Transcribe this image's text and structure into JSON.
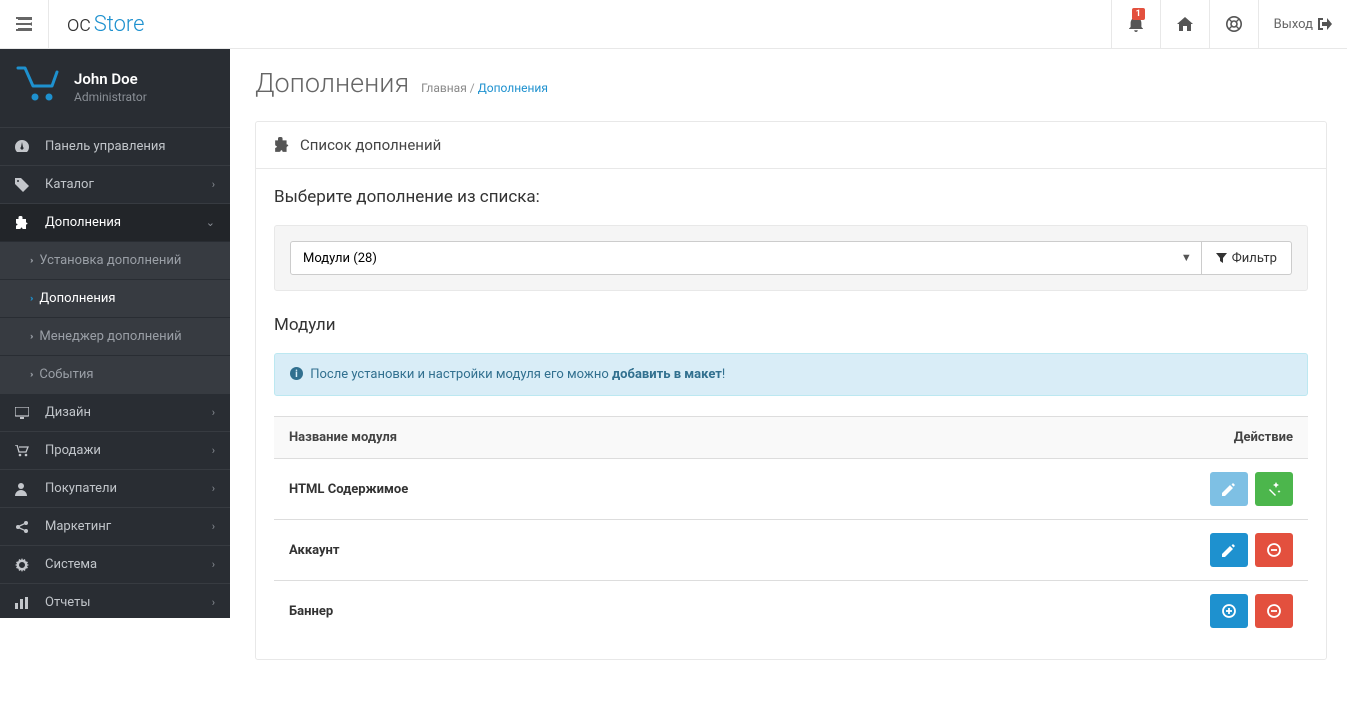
{
  "header": {
    "logo_oc": "oc",
    "logo_store": "Store",
    "notification_count": "1",
    "logout_label": "Выход"
  },
  "user": {
    "name": "John Doe",
    "role": "Administrator"
  },
  "sidebar": {
    "dashboard": "Панель управления",
    "catalog": "Каталог",
    "extensions": "Дополнения",
    "design": "Дизайн",
    "sales": "Продажи",
    "customers": "Покупатели",
    "marketing": "Маркетинг",
    "system": "Система",
    "reports": "Отчеты",
    "sub": {
      "installer": "Установка дополнений",
      "extensions": "Дополнения",
      "modifications": "Менеджер дополнений",
      "events": "События"
    }
  },
  "page": {
    "title": "Дополнения",
    "breadcrumb_home": "Главная",
    "breadcrumb_sep": " / ",
    "breadcrumb_current": "Дополнения"
  },
  "panel": {
    "heading": "Список дополнений",
    "select_label": "Выберите дополнение из списка:",
    "select_value": "Модули (28)",
    "filter_label": "Фильтр",
    "subtitle": "Модули",
    "alert_pre": "После установки и настройки модуля его можно ",
    "alert_bold": "добавить в макет",
    "alert_post": "!"
  },
  "table": {
    "col_name": "Название модуля",
    "col_action": "Действие",
    "rows": [
      {
        "name": "HTML Содержимое",
        "kind": "editwand"
      },
      {
        "name": "Аккаунт",
        "kind": "editdelete"
      },
      {
        "name": "Баннер",
        "kind": "adddelete"
      }
    ]
  }
}
